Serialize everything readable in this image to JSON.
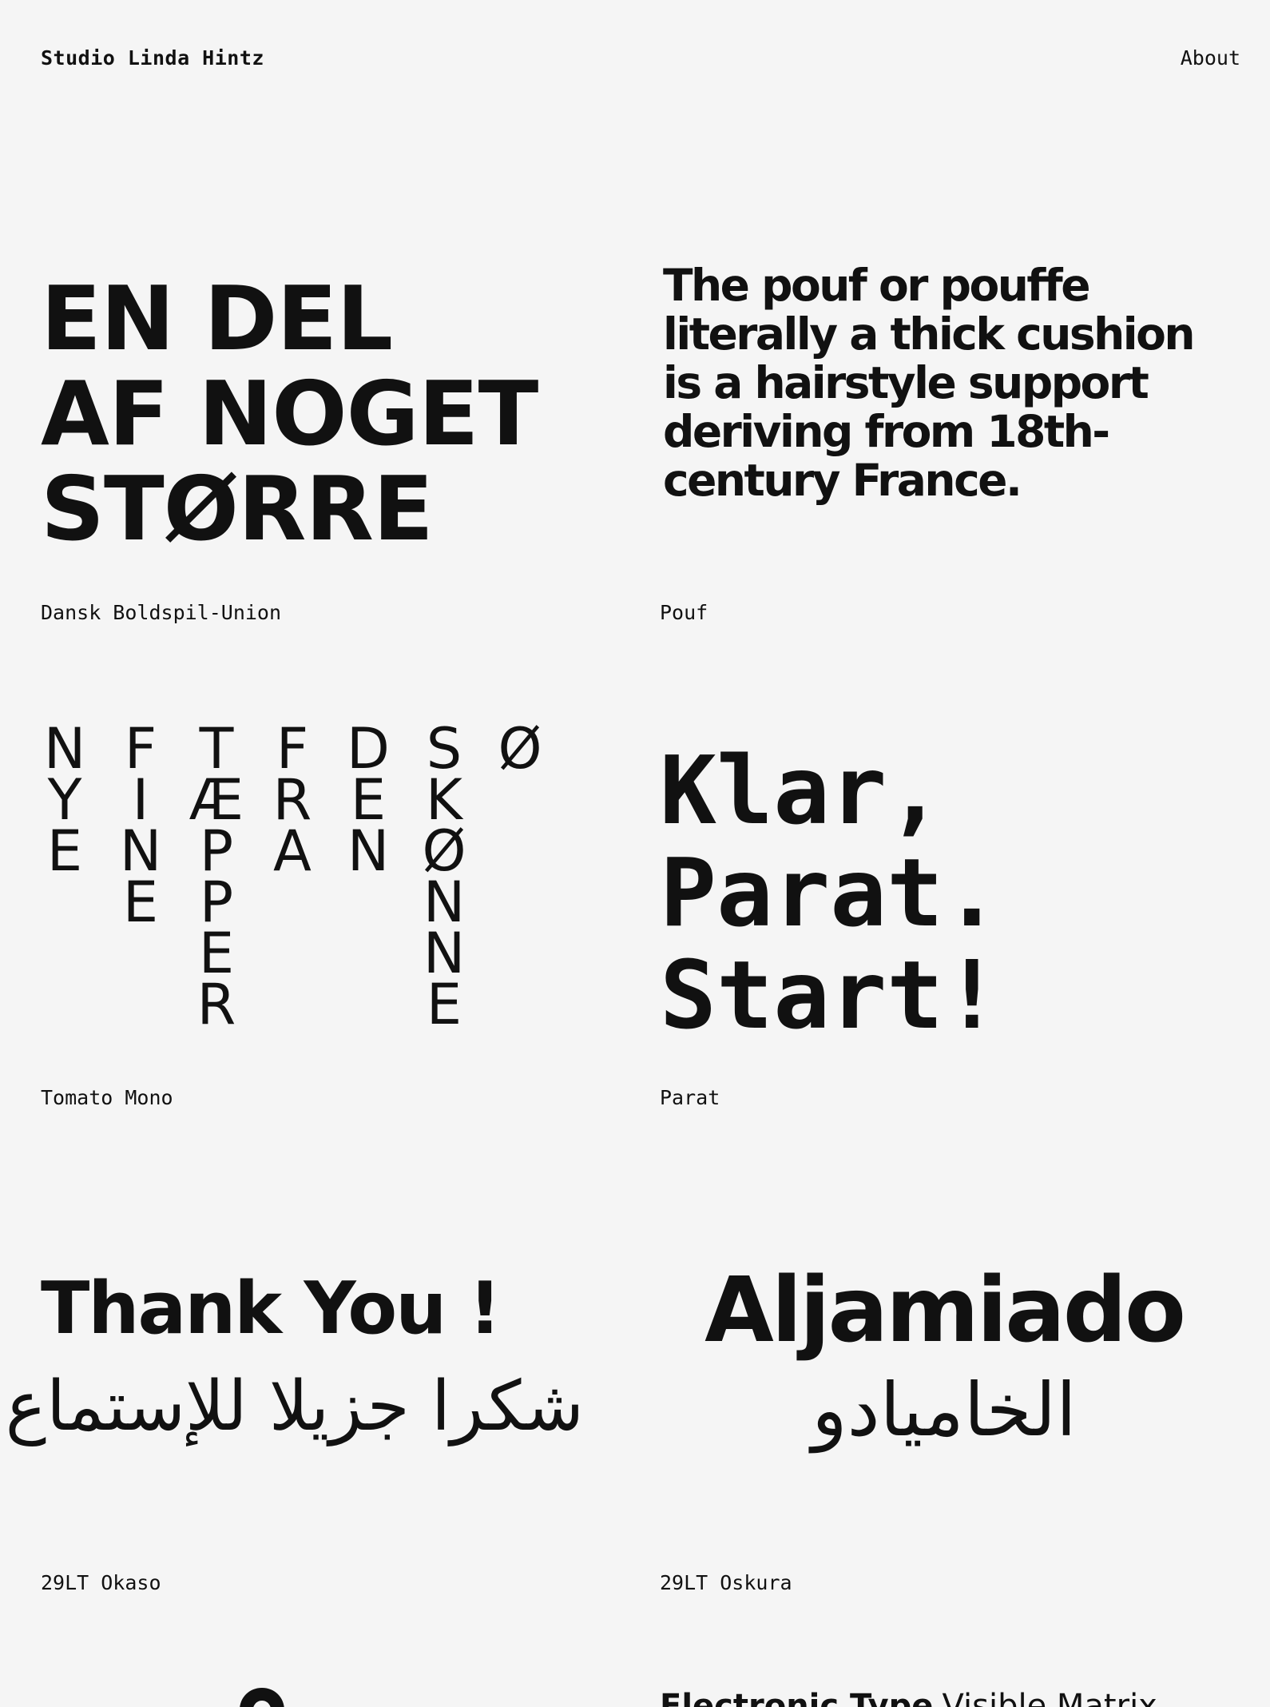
{
  "header": {
    "brand": "Studio Linda Hintz",
    "about": "About"
  },
  "projects": [
    {
      "name": "Dansk Boldspil-Union",
      "lines": [
        "EN DEL",
        "AF NOGET",
        "STØRRE"
      ]
    },
    {
      "name": "Pouf",
      "text": "The pouf or pouffe literally a thick cushion is a hairstyle support deriving from 18th-century France."
    },
    {
      "name": "Tomato Mono",
      "columns": [
        "NYE",
        "FINE",
        "TÆPPER",
        "FRA",
        "DEN",
        "SKØNNE",
        "Ø"
      ]
    },
    {
      "name": "Parat",
      "lines": [
        "Klar,",
        "Parat.",
        "Start!"
      ]
    },
    {
      "name": "29LT Okaso",
      "latin": "Thank You !",
      "arabic": "شكرا جزيلا للإستماع"
    },
    {
      "name": "29LT Oskura",
      "latin": "Aljamiado",
      "arabic": "الخاميادو"
    },
    {
      "name": "",
      "icon": "studio-logo-icon"
    },
    {
      "name": "",
      "bold": "Electronic Type",
      "light": "Visible Matrix"
    }
  ]
}
